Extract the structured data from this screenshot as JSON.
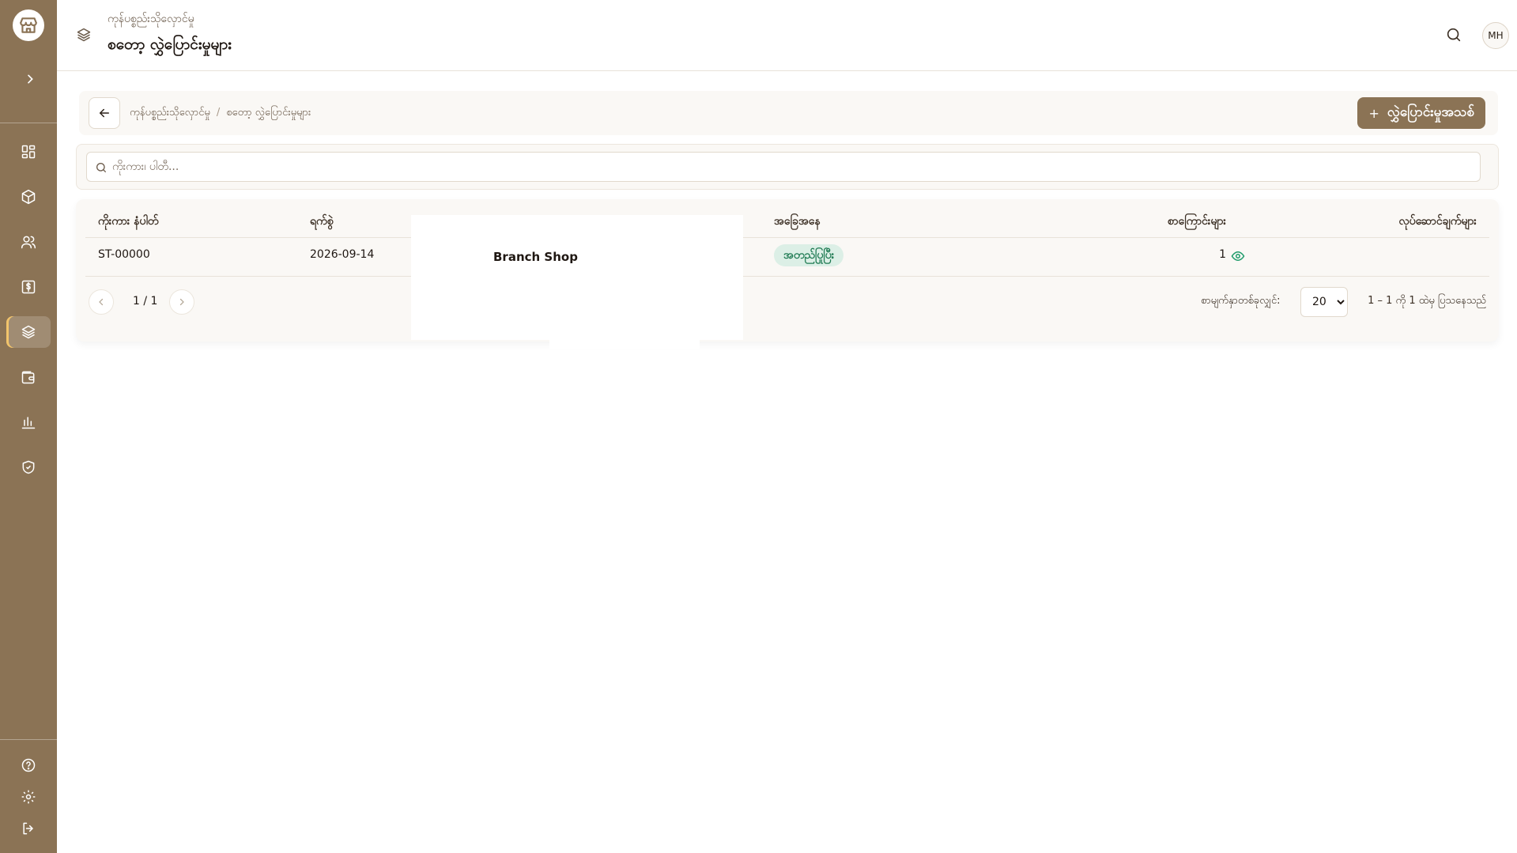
{
  "header": {
    "subtitle": "ကုန်ပစ္စည်းသိုလှောင်မှု",
    "title": "စတော့ လွှဲပြောင်းမှုများ",
    "avatar_initials": "MH"
  },
  "sidebar": {
    "items": [
      {
        "icon": "dashboard-icon"
      },
      {
        "icon": "box-icon"
      },
      {
        "icon": "users-icon"
      },
      {
        "icon": "invoice-icon"
      },
      {
        "icon": "layers-icon",
        "active": true
      },
      {
        "icon": "wallet-icon"
      },
      {
        "icon": "bar-chart-icon"
      },
      {
        "icon": "shield-check-icon"
      }
    ],
    "bottom": [
      {
        "icon": "help-icon"
      },
      {
        "icon": "settings-icon"
      },
      {
        "icon": "logout-icon"
      }
    ]
  },
  "breadcrumb": {
    "parent": "ကုန်ပစ္စည်းသိုလှောင်မှု",
    "separator": "/",
    "current": "စတော့ လွှဲပြောင်းမှုများ"
  },
  "new_button": {
    "plus": "+",
    "label": "လွှဲပြောင်းမှုအသစ်"
  },
  "search": {
    "placeholder": "ကိုးကား၊ ပါတီ..."
  },
  "table": {
    "columns": {
      "reference": "ကိုးကား နံပါတ်",
      "date": "ရက်စွဲ",
      "status": "အခြေအနေ",
      "lines": "စာကြောင်းများ",
      "actions": "လုပ်ဆောင်ချက်များ"
    },
    "rows": [
      {
        "reference": "ST-00000",
        "date": "2026-09-14",
        "status": "အတည်ပြုပြီး",
        "lines": "1"
      }
    ]
  },
  "pagination": {
    "page_text": "1 / 1",
    "per_page_label": "စာမျက်နှာတစ်ခုလျှင်:",
    "per_page_value": "20",
    "per_page_options": [
      "20"
    ],
    "range_text": "1 – 1 ကို 1 ထဲမှ ပြသနေသည်"
  },
  "overlay": {
    "text": "Branch Shop"
  },
  "colors": {
    "sidebar": "#8b7355",
    "accent": "#8b7355",
    "status_bg": "#dcefe6",
    "status_text": "#1e7a52"
  }
}
